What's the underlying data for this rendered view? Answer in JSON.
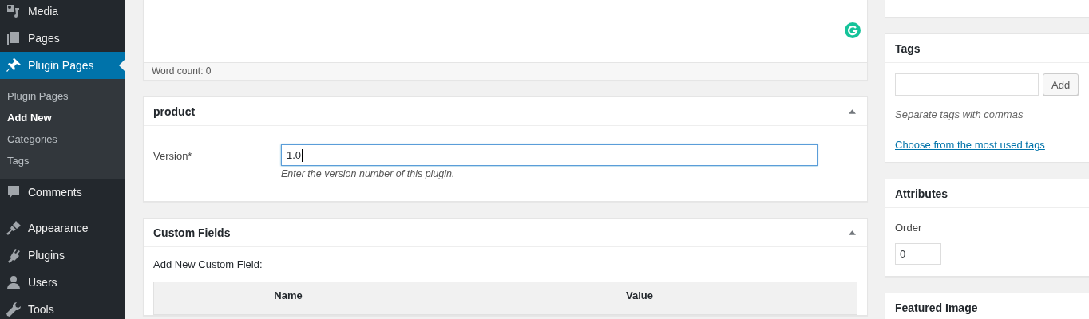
{
  "sidebar": {
    "items": [
      {
        "label": "Media",
        "selected": false
      },
      {
        "label": "Pages",
        "selected": false
      },
      {
        "label": "Plugin Pages",
        "selected": true,
        "children": [
          {
            "label": "Plugin Pages",
            "selected": false
          },
          {
            "label": "Add New",
            "selected": true
          },
          {
            "label": "Categories",
            "selected": false
          },
          {
            "label": "Tags",
            "selected": false
          }
        ]
      },
      {
        "label": "Comments",
        "selected": false
      },
      {
        "label": "Appearance",
        "selected": false
      },
      {
        "label": "Plugins",
        "selected": false
      },
      {
        "label": "Users",
        "selected": false
      },
      {
        "label": "Tools",
        "selected": false
      }
    ]
  },
  "editor": {
    "word_count": "Word count: 0"
  },
  "product_box": {
    "title": "product",
    "expanded": true,
    "field": {
      "label": "Version*",
      "value": "1.0",
      "description": "Enter the version number of this plugin."
    }
  },
  "custom_fields": {
    "title": "Custom Fields",
    "expanded": true,
    "subtitle": "Add New Custom Field:",
    "columns": [
      "Name",
      "Value"
    ]
  },
  "tags_box": {
    "title": "Tags",
    "button": "Add",
    "hint": "Separate tags with commas",
    "link": "Choose from the most used tags"
  },
  "attributes_box": {
    "title": "Attributes",
    "order_label": "Order",
    "order_value": "0"
  },
  "featured_image_box": {
    "title": "Featured Image"
  }
}
